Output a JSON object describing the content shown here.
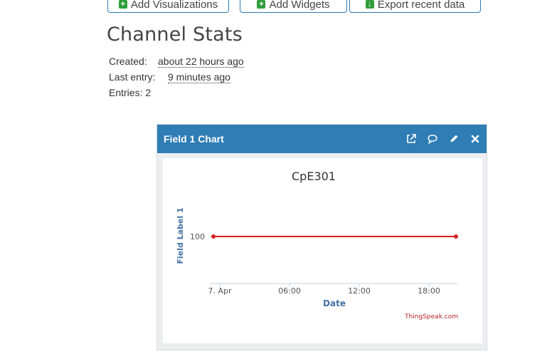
{
  "toolbar": {
    "add_visualizations": "Add Visualizations",
    "add_widgets": "Add Widgets",
    "export_recent": "Export recent data"
  },
  "stats": {
    "title": "Channel Stats",
    "created_label": "Created:",
    "created_value": "about 22 hours ago",
    "last_entry_label": "Last entry:",
    "last_entry_value": "9 minutes ago",
    "entries_label": "Entries:",
    "entries_value": "2"
  },
  "panel": {
    "title": "Field 1 Chart",
    "icons": [
      "external-link-icon",
      "comment-icon",
      "pencil-icon",
      "close-icon"
    ]
  },
  "chart_data": {
    "type": "line",
    "title": "CpE301",
    "xlabel": "Date",
    "ylabel": "Field Label 1",
    "x_ticks": [
      "7. Apr",
      "06:00",
      "12:00",
      "18:00"
    ],
    "y_ticks": [
      "100"
    ],
    "series": [
      {
        "values": [
          100,
          100
        ],
        "x": [
          "7. Apr 00:00",
          "7. Apr 20:50"
        ],
        "color": "#d62020"
      }
    ],
    "credit": "ThingSpeak.com",
    "grid": false
  },
  "colors": {
    "panel_header": "#2f7db5",
    "series": "#d62020",
    "axis_label": "#4572a7",
    "button_plus": "#2f9e3a"
  }
}
